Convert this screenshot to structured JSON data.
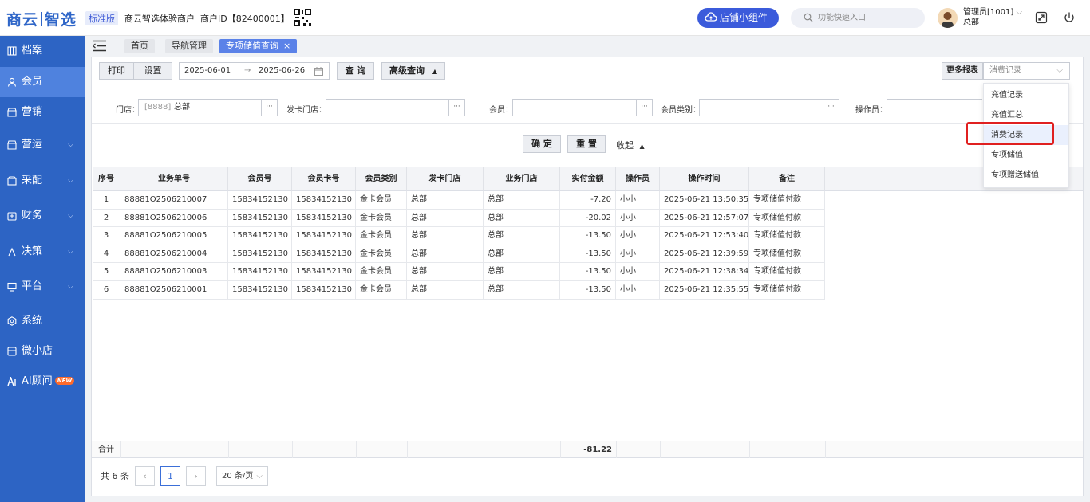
{
  "header": {
    "logo": "商云智选",
    "logo_part1": "商云",
    "logo_part2": "智选",
    "edition": "标准版",
    "merchant_name": "商云智选体验商户",
    "merchant_id": "商户ID【82400001】",
    "widget_button": "店铺小组件",
    "search_placeholder": "功能快速入口",
    "admin_name": "管理员[1001]",
    "admin_org": "总部"
  },
  "sidebar": {
    "items": [
      {
        "label": "档案",
        "icon": "archive-icon"
      },
      {
        "label": "会员",
        "icon": "user-icon",
        "active": true
      },
      {
        "label": "营销",
        "icon": "shop-icon"
      },
      {
        "label": "营运",
        "icon": "store-icon",
        "expandable": true
      },
      {
        "label": "采配",
        "icon": "box-icon",
        "expandable": true
      },
      {
        "label": "财务",
        "icon": "wallet-icon",
        "expandable": true
      },
      {
        "label": "决策",
        "icon": "decision-icon",
        "expandable": true
      },
      {
        "label": "平台",
        "icon": "monitor-icon",
        "expandable": true
      },
      {
        "label": "系统",
        "icon": "settings-icon"
      },
      {
        "label": "微小店",
        "icon": "mini-store-icon"
      },
      {
        "label": "AI顾问",
        "icon": "ai-icon",
        "badge": "NEW"
      }
    ]
  },
  "tabs": [
    {
      "label": "首页"
    },
    {
      "label": "导航管理"
    },
    {
      "label": "专项储值查询",
      "active": true,
      "close": "×"
    }
  ],
  "toolbar": {
    "print": "打印",
    "settings": "设置",
    "date_from": "2025-06-01",
    "date_arrow": "→",
    "date_to": "2025-06-26",
    "query": "查 询",
    "advanced": "高级查询",
    "advanced_arrow": "▲",
    "more_reports": "更多报表",
    "report_selected": "消费记录"
  },
  "filters": {
    "store_label": "门店：",
    "store_code": "[8888]",
    "store_value": "总部",
    "card_store_label": "发卡门店：",
    "member_label": "会员：",
    "member_type_label": "会员类别：",
    "operator_label": "操作员：",
    "dots": "···"
  },
  "actions": {
    "confirm": "确 定",
    "reset": "重 置",
    "collapse": "收起",
    "collapse_arrow": "▲"
  },
  "dropdown": {
    "options": [
      "充值记录",
      "充值汇总",
      "消费记录",
      "专项储值",
      "专项赠送储值"
    ],
    "selected_index": 2
  },
  "table": {
    "columns": [
      "序号",
      "业务单号",
      "会员号",
      "会员卡号",
      "会员类别",
      "发卡门店",
      "业务门店",
      "实付金额",
      "操作员",
      "操作时间",
      "备注"
    ],
    "rows": [
      [
        "1",
        "88881O2506210007",
        "15834152130",
        "15834152130",
        "金卡会员",
        "总部",
        "总部",
        "-7.20",
        "小小",
        "2025-06-21 13:50:35",
        "专项储值付款"
      ],
      [
        "2",
        "88881O2506210006",
        "15834152130",
        "15834152130",
        "金卡会员",
        "总部",
        "总部",
        "-20.02",
        "小小",
        "2025-06-21 12:57:07",
        "专项储值付款"
      ],
      [
        "3",
        "88881O2506210005",
        "15834152130",
        "15834152130",
        "金卡会员",
        "总部",
        "总部",
        "-13.50",
        "小小",
        "2025-06-21 12:53:40",
        "专项储值付款"
      ],
      [
        "4",
        "88881O2506210004",
        "15834152130",
        "15834152130",
        "金卡会员",
        "总部",
        "总部",
        "-13.50",
        "小小",
        "2025-06-21 12:39:59",
        "专项储值付款"
      ],
      [
        "5",
        "88881O2506210003",
        "15834152130",
        "15834152130",
        "金卡会员",
        "总部",
        "总部",
        "-13.50",
        "小小",
        "2025-06-21 12:38:34",
        "专项储值付款"
      ],
      [
        "6",
        "88881O2506210001",
        "15834152130",
        "15834152130",
        "金卡会员",
        "总部",
        "总部",
        "-13.50",
        "小小",
        "2025-06-21 12:35:55",
        "专项储值付款"
      ]
    ],
    "footer_label": "合计",
    "footer_total": "-81.22"
  },
  "pagination": {
    "total_text": "共 6 条",
    "prev": "‹",
    "current_page": "1",
    "next": "›",
    "page_size": "20 条/页",
    "page_size_arrow": "⌵"
  },
  "colors": {
    "brand": "#2d64c4",
    "accent": "#3b5bdb",
    "highlight": "#e02020"
  }
}
